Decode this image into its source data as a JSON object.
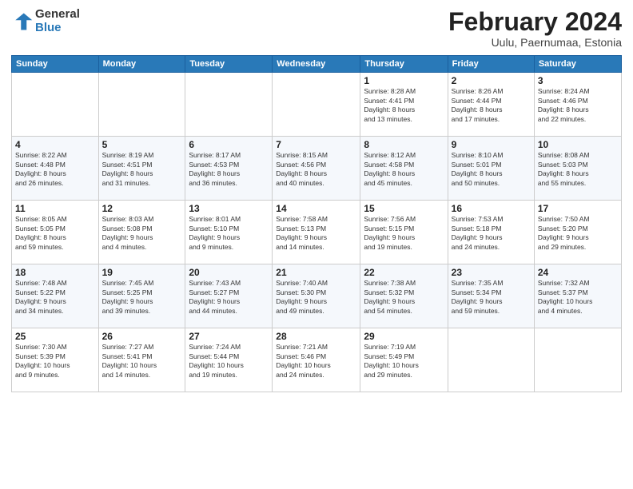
{
  "header": {
    "logo_general": "General",
    "logo_blue": "Blue",
    "title": "February 2024",
    "location": "Uulu, Paernumaa, Estonia"
  },
  "days_of_week": [
    "Sunday",
    "Monday",
    "Tuesday",
    "Wednesday",
    "Thursday",
    "Friday",
    "Saturday"
  ],
  "weeks": [
    [
      {
        "day": "",
        "info": ""
      },
      {
        "day": "",
        "info": ""
      },
      {
        "day": "",
        "info": ""
      },
      {
        "day": "",
        "info": ""
      },
      {
        "day": "1",
        "info": "Sunrise: 8:28 AM\nSunset: 4:41 PM\nDaylight: 8 hours\nand 13 minutes."
      },
      {
        "day": "2",
        "info": "Sunrise: 8:26 AM\nSunset: 4:44 PM\nDaylight: 8 hours\nand 17 minutes."
      },
      {
        "day": "3",
        "info": "Sunrise: 8:24 AM\nSunset: 4:46 PM\nDaylight: 8 hours\nand 22 minutes."
      }
    ],
    [
      {
        "day": "4",
        "info": "Sunrise: 8:22 AM\nSunset: 4:48 PM\nDaylight: 8 hours\nand 26 minutes."
      },
      {
        "day": "5",
        "info": "Sunrise: 8:19 AM\nSunset: 4:51 PM\nDaylight: 8 hours\nand 31 minutes."
      },
      {
        "day": "6",
        "info": "Sunrise: 8:17 AM\nSunset: 4:53 PM\nDaylight: 8 hours\nand 36 minutes."
      },
      {
        "day": "7",
        "info": "Sunrise: 8:15 AM\nSunset: 4:56 PM\nDaylight: 8 hours\nand 40 minutes."
      },
      {
        "day": "8",
        "info": "Sunrise: 8:12 AM\nSunset: 4:58 PM\nDaylight: 8 hours\nand 45 minutes."
      },
      {
        "day": "9",
        "info": "Sunrise: 8:10 AM\nSunset: 5:01 PM\nDaylight: 8 hours\nand 50 minutes."
      },
      {
        "day": "10",
        "info": "Sunrise: 8:08 AM\nSunset: 5:03 PM\nDaylight: 8 hours\nand 55 minutes."
      }
    ],
    [
      {
        "day": "11",
        "info": "Sunrise: 8:05 AM\nSunset: 5:05 PM\nDaylight: 8 hours\nand 59 minutes."
      },
      {
        "day": "12",
        "info": "Sunrise: 8:03 AM\nSunset: 5:08 PM\nDaylight: 9 hours\nand 4 minutes."
      },
      {
        "day": "13",
        "info": "Sunrise: 8:01 AM\nSunset: 5:10 PM\nDaylight: 9 hours\nand 9 minutes."
      },
      {
        "day": "14",
        "info": "Sunrise: 7:58 AM\nSunset: 5:13 PM\nDaylight: 9 hours\nand 14 minutes."
      },
      {
        "day": "15",
        "info": "Sunrise: 7:56 AM\nSunset: 5:15 PM\nDaylight: 9 hours\nand 19 minutes."
      },
      {
        "day": "16",
        "info": "Sunrise: 7:53 AM\nSunset: 5:18 PM\nDaylight: 9 hours\nand 24 minutes."
      },
      {
        "day": "17",
        "info": "Sunrise: 7:50 AM\nSunset: 5:20 PM\nDaylight: 9 hours\nand 29 minutes."
      }
    ],
    [
      {
        "day": "18",
        "info": "Sunrise: 7:48 AM\nSunset: 5:22 PM\nDaylight: 9 hours\nand 34 minutes."
      },
      {
        "day": "19",
        "info": "Sunrise: 7:45 AM\nSunset: 5:25 PM\nDaylight: 9 hours\nand 39 minutes."
      },
      {
        "day": "20",
        "info": "Sunrise: 7:43 AM\nSunset: 5:27 PM\nDaylight: 9 hours\nand 44 minutes."
      },
      {
        "day": "21",
        "info": "Sunrise: 7:40 AM\nSunset: 5:30 PM\nDaylight: 9 hours\nand 49 minutes."
      },
      {
        "day": "22",
        "info": "Sunrise: 7:38 AM\nSunset: 5:32 PM\nDaylight: 9 hours\nand 54 minutes."
      },
      {
        "day": "23",
        "info": "Sunrise: 7:35 AM\nSunset: 5:34 PM\nDaylight: 9 hours\nand 59 minutes."
      },
      {
        "day": "24",
        "info": "Sunrise: 7:32 AM\nSunset: 5:37 PM\nDaylight: 10 hours\nand 4 minutes."
      }
    ],
    [
      {
        "day": "25",
        "info": "Sunrise: 7:30 AM\nSunset: 5:39 PM\nDaylight: 10 hours\nand 9 minutes."
      },
      {
        "day": "26",
        "info": "Sunrise: 7:27 AM\nSunset: 5:41 PM\nDaylight: 10 hours\nand 14 minutes."
      },
      {
        "day": "27",
        "info": "Sunrise: 7:24 AM\nSunset: 5:44 PM\nDaylight: 10 hours\nand 19 minutes."
      },
      {
        "day": "28",
        "info": "Sunrise: 7:21 AM\nSunset: 5:46 PM\nDaylight: 10 hours\nand 24 minutes."
      },
      {
        "day": "29",
        "info": "Sunrise: 7:19 AM\nSunset: 5:49 PM\nDaylight: 10 hours\nand 29 minutes."
      },
      {
        "day": "",
        "info": ""
      },
      {
        "day": "",
        "info": ""
      }
    ]
  ]
}
